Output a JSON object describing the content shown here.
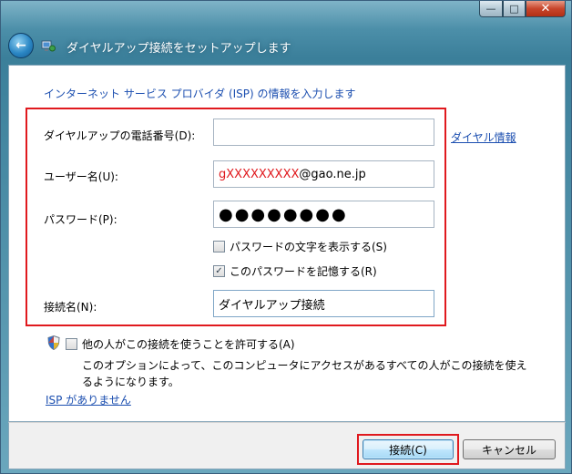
{
  "titlebar": {
    "min_label": "—",
    "max_label": "□",
    "close_label": "✕"
  },
  "nav": {
    "back_label": "←",
    "title": "ダイヤルアップ接続をセットアップします"
  },
  "heading": "インターネット サービス プロバイダ (ISP) の情報を入力します",
  "form": {
    "phone_label": "ダイヤルアップの電話番号(D):",
    "phone_value": "",
    "dial_info_link": "ダイヤル情報",
    "username_label": "ユーザー名(U):",
    "username_red": "gXXXXXXXXX",
    "username_rest": "@gao.ne.jp",
    "password_label": "パスワード(P):",
    "password_mask": "●●●●●●●●",
    "show_password_label": "パスワードの文字を表示する(S)",
    "show_password_checked": false,
    "remember_password_label": "このパスワードを記憶する(R)",
    "remember_password_checked": true,
    "connection_name_label": "接続名(N):",
    "connection_name_value": "ダイヤルアップ接続"
  },
  "allow_others": {
    "label": "他の人がこの接続を使うことを許可する(A)",
    "checked": false,
    "description": "このオプションによって、このコンピュータにアクセスがあるすべての人がこの接続を使えるようになります。"
  },
  "no_isp_link": "ISP がありません",
  "footer": {
    "connect_label": "接続(C)",
    "cancel_label": "キャンセル"
  },
  "colors": {
    "accent_link": "#1c4fb0",
    "highlight": "#e0191e"
  }
}
